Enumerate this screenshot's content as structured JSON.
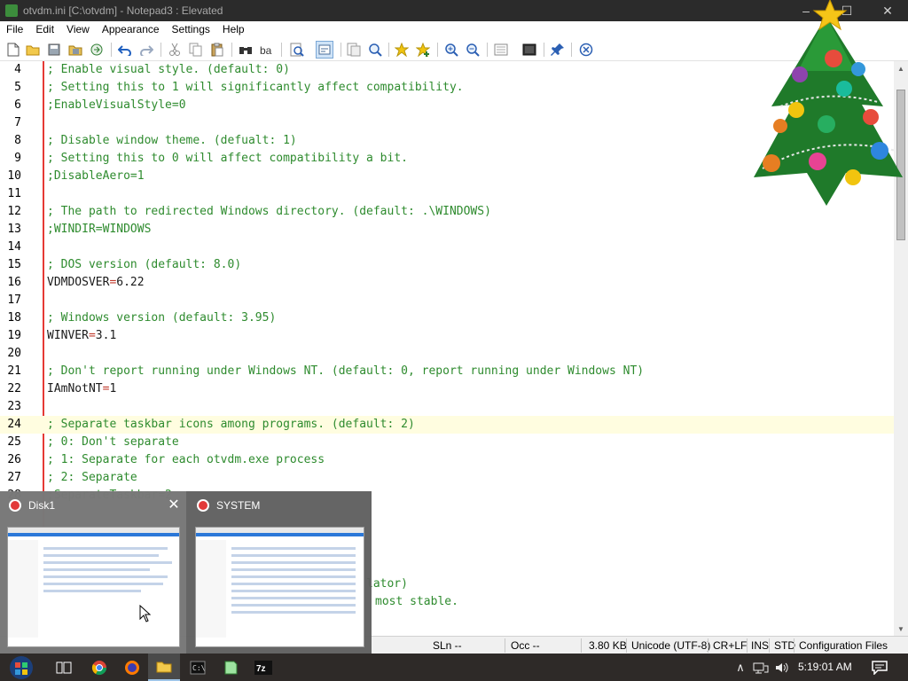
{
  "window": {
    "title": "otvdm.ini [C:\\otvdm] - Notepad3 : Elevated",
    "min_glyph": "–",
    "max_glyph": "☐",
    "close_glyph": "✕"
  },
  "menu": [
    "File",
    "Edit",
    "View",
    "Appearance",
    "Settings",
    "Help"
  ],
  "toolbar_icons": [
    "new-icon",
    "open-icon",
    "save-icon",
    "save-all-icon",
    "browse-icon",
    "undo-icon",
    "redo-icon",
    "cut-icon",
    "copy-icon",
    "paste-icon",
    "find-icon",
    "replace-icon",
    "find-in-files-icon",
    "word-wrap-icon",
    "view-whitespace-icon",
    "zoom-icon",
    "favorite-icon",
    "add-favorite-icon",
    "zoom-in-icon",
    "zoom-out-icon",
    "scheme-icon",
    "customize-icon",
    "pin-icon",
    "close-file-icon"
  ],
  "editor": {
    "lines": [
      {
        "n": "4",
        "segments": [
          {
            "t": "; Enable visual style. (default: 0)",
            "c": "cmt"
          }
        ]
      },
      {
        "n": "5",
        "segments": [
          {
            "t": "; Setting this to 1 will significantly affect compatibility.",
            "c": "cmt"
          }
        ]
      },
      {
        "n": "6",
        "segments": [
          {
            "t": ";EnableVisualStyle=0",
            "c": "cmt"
          }
        ]
      },
      {
        "n": "7",
        "segments": []
      },
      {
        "n": "8",
        "segments": [
          {
            "t": "; Disable window theme. (defualt: 1)",
            "c": "cmt"
          }
        ]
      },
      {
        "n": "9",
        "segments": [
          {
            "t": "; Setting this to 0 will affect compatibility a bit.",
            "c": "cmt"
          }
        ]
      },
      {
        "n": "10",
        "segments": [
          {
            "t": ";DisableAero=1",
            "c": "cmt"
          }
        ]
      },
      {
        "n": "11",
        "segments": []
      },
      {
        "n": "12",
        "segments": [
          {
            "t": "; The path to redirected Windows directory. (default: .\\WINDOWS)",
            "c": "cmt"
          }
        ]
      },
      {
        "n": "13",
        "segments": [
          {
            "t": ";WINDIR=WINDOWS",
            "c": "cmt"
          }
        ]
      },
      {
        "n": "14",
        "segments": []
      },
      {
        "n": "15",
        "segments": [
          {
            "t": "; DOS version (default: 8.0)",
            "c": "cmt"
          }
        ]
      },
      {
        "n": "16",
        "segments": [
          {
            "t": "VDMDOSVER",
            "c": "key"
          },
          {
            "t": "=",
            "c": "eq"
          },
          {
            "t": "6.22",
            "c": "val"
          }
        ]
      },
      {
        "n": "17",
        "segments": []
      },
      {
        "n": "18",
        "segments": [
          {
            "t": "; Windows version (default: 3.95)",
            "c": "cmt"
          }
        ]
      },
      {
        "n": "19",
        "segments": [
          {
            "t": "WINVER",
            "c": "key"
          },
          {
            "t": "=",
            "c": "eq"
          },
          {
            "t": "3.1",
            "c": "val"
          }
        ]
      },
      {
        "n": "20",
        "segments": []
      },
      {
        "n": "21",
        "segments": [
          {
            "t": "; Don't report running under Windows NT. (default: 0, report running under Windows NT)",
            "c": "cmt"
          }
        ]
      },
      {
        "n": "22",
        "segments": [
          {
            "t": "IAmNotNT",
            "c": "key"
          },
          {
            "t": "=",
            "c": "eq"
          },
          {
            "t": "1",
            "c": "val"
          }
        ]
      },
      {
        "n": "23",
        "segments": []
      },
      {
        "n": "24",
        "segments": [
          {
            "t": "; Separate taskbar icons among programs. (default: 2)",
            "c": "cmt"
          }
        ],
        "current": true
      },
      {
        "n": "25",
        "segments": [
          {
            "t": "; 0: Don't separate",
            "c": "cmt"
          }
        ]
      },
      {
        "n": "26",
        "segments": [
          {
            "t": "; 1: Separate for each otvdm.exe process",
            "c": "cmt"
          }
        ]
      },
      {
        "n": "27",
        "segments": [
          {
            "t": "; 2: Separate",
            "c": "cmt"
          }
        ]
      },
      {
        "n": "28",
        "segments": [
          {
            "t": ";SeparateTaskbar=2",
            "c": "cmt"
          }
        ]
      }
    ],
    "fragment_1": "lator)",
    "fragment_2": "most stable."
  },
  "status": {
    "sln": "SLn  --",
    "occ": "Occ  --",
    "size": "3.80 KB",
    "encoding": "Unicode (UTF-8)",
    "eol": "CR+LF",
    "ins": "INS",
    "std": "STD",
    "scheme": "Configuration Files"
  },
  "thumbnails": [
    {
      "title": "Disk1"
    },
    {
      "title": "SYSTEM"
    }
  ],
  "taskbar": {
    "clock": "5:19:01 AM"
  }
}
